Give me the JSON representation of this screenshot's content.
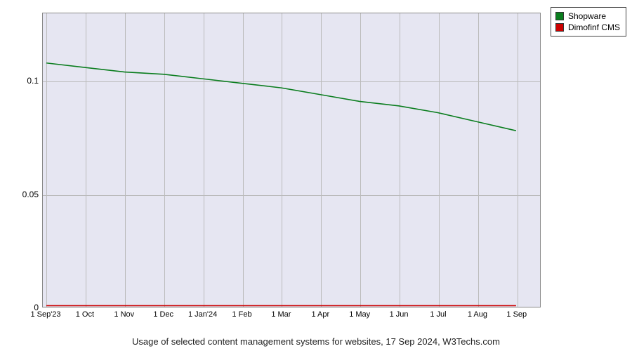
{
  "chart_data": {
    "type": "line",
    "title": "",
    "xlabel": "",
    "ylabel": "",
    "ylim": [
      0,
      0.13
    ],
    "y_ticks": [
      0,
      0.05,
      0.1
    ],
    "categories": [
      "1 Sep'23",
      "1 Oct",
      "1 Nov",
      "1 Dec",
      "1 Jan'24",
      "1 Feb",
      "1 Mar",
      "1 Apr",
      "1 May",
      "1 Jun",
      "1 Jul",
      "1 Aug",
      "1 Sep"
    ],
    "series": [
      {
        "name": "Shopware",
        "color": "#0a7d1e",
        "values": [
          0.108,
          0.106,
          0.104,
          0.103,
          0.101,
          0.099,
          0.097,
          0.094,
          0.091,
          0.089,
          0.086,
          0.082,
          0.078
        ]
      },
      {
        "name": "Dimofinf CMS",
        "color": "#cc0000",
        "values": [
          0.0005,
          0.0005,
          0.0005,
          0.0005,
          0.0005,
          0.0005,
          0.0005,
          0.0005,
          0.0005,
          0.0005,
          0.0005,
          0.0005,
          0.0005
        ]
      }
    ],
    "caption": "Usage of selected content management systems for websites, 17 Sep 2024, W3Techs.com"
  },
  "y_tick_labels": [
    "0",
    "0.05",
    "0.1"
  ],
  "legend": {
    "items": [
      {
        "label": "Shopware",
        "color": "#0a7d1e"
      },
      {
        "label": "Dimofinf CMS",
        "color": "#cc0000"
      }
    ]
  }
}
